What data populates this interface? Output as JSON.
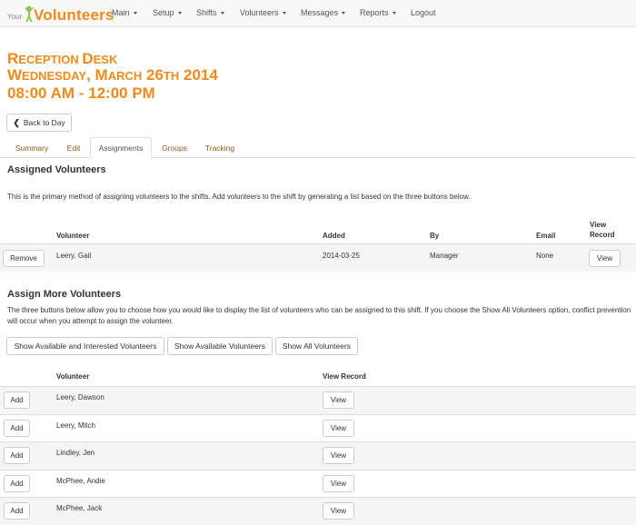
{
  "brand": {
    "prefix": "Your",
    "name": "Volunteers"
  },
  "nav": {
    "main": "Main",
    "setup": "Setup",
    "shifts": "Shifts",
    "volunteers": "Volunteers",
    "messages": "Messages",
    "reports": "Reports",
    "logout": "Logout"
  },
  "header": {
    "title_first": "R",
    "title_rest": "ECEPTION ",
    "title2_first": "D",
    "title2_rest": "ESK",
    "date_w": "W",
    "date_w_rest": "EDNESDAY",
    "date_comma": ", ",
    "date_m": "M",
    "date_m_rest": "ARCH",
    "date_day": " 26",
    "date_th": "TH",
    "date_year": " 2014",
    "time": "08:00 AM - 12:00 PM"
  },
  "back_button": "Back to Day",
  "tabs": [
    "Summary",
    "Edit",
    "Assignments",
    "Groups",
    "Tracking"
  ],
  "assigned": {
    "heading": "Assigned Volunteers",
    "description": "This is the primary method of assigning volunteers to the shifts. Add volunteers to the shift by generating a list based on the three buttons below.",
    "columns": {
      "volunteer": "Volunteer",
      "added": "Added",
      "by": "By",
      "email": "Email",
      "view1": "View",
      "view2": "Record"
    },
    "rows": [
      {
        "action": "Remove",
        "volunteer": "Leery, Gail",
        "added": "2014-03-25",
        "by": "Manager",
        "email": "None",
        "view": "View"
      }
    ]
  },
  "assign_more": {
    "heading": "Assign More Volunteers",
    "description": "The three buttons below allow you to choose how you would like to display the list of volunteers who can be assigned to this shift. If you choose the Show All Volunteers option, conflict prevention will occur when you attempt to assign the volunteer.",
    "filter_buttons": [
      "Show Available and Interested Volunteers",
      "Show Available Volunteers",
      "Show All Volunteers"
    ],
    "columns": {
      "volunteer": "Volunteer",
      "view": "View Record"
    },
    "rows": [
      {
        "action": "Add",
        "volunteer": "Leery, Dawson",
        "view": "View"
      },
      {
        "action": "Add",
        "volunteer": "Leery, Mitch",
        "view": "View"
      },
      {
        "action": "Add",
        "volunteer": "Lindley, Jen",
        "view": "View"
      },
      {
        "action": "Add",
        "volunteer": "McPhee, Andie",
        "view": "View"
      },
      {
        "action": "Add",
        "volunteer": "McPhee, Jack",
        "view": "View"
      }
    ]
  },
  "colors": {
    "accent": "#f08a1c",
    "stripe": "#f5f5f5",
    "border": "#dddddd"
  }
}
